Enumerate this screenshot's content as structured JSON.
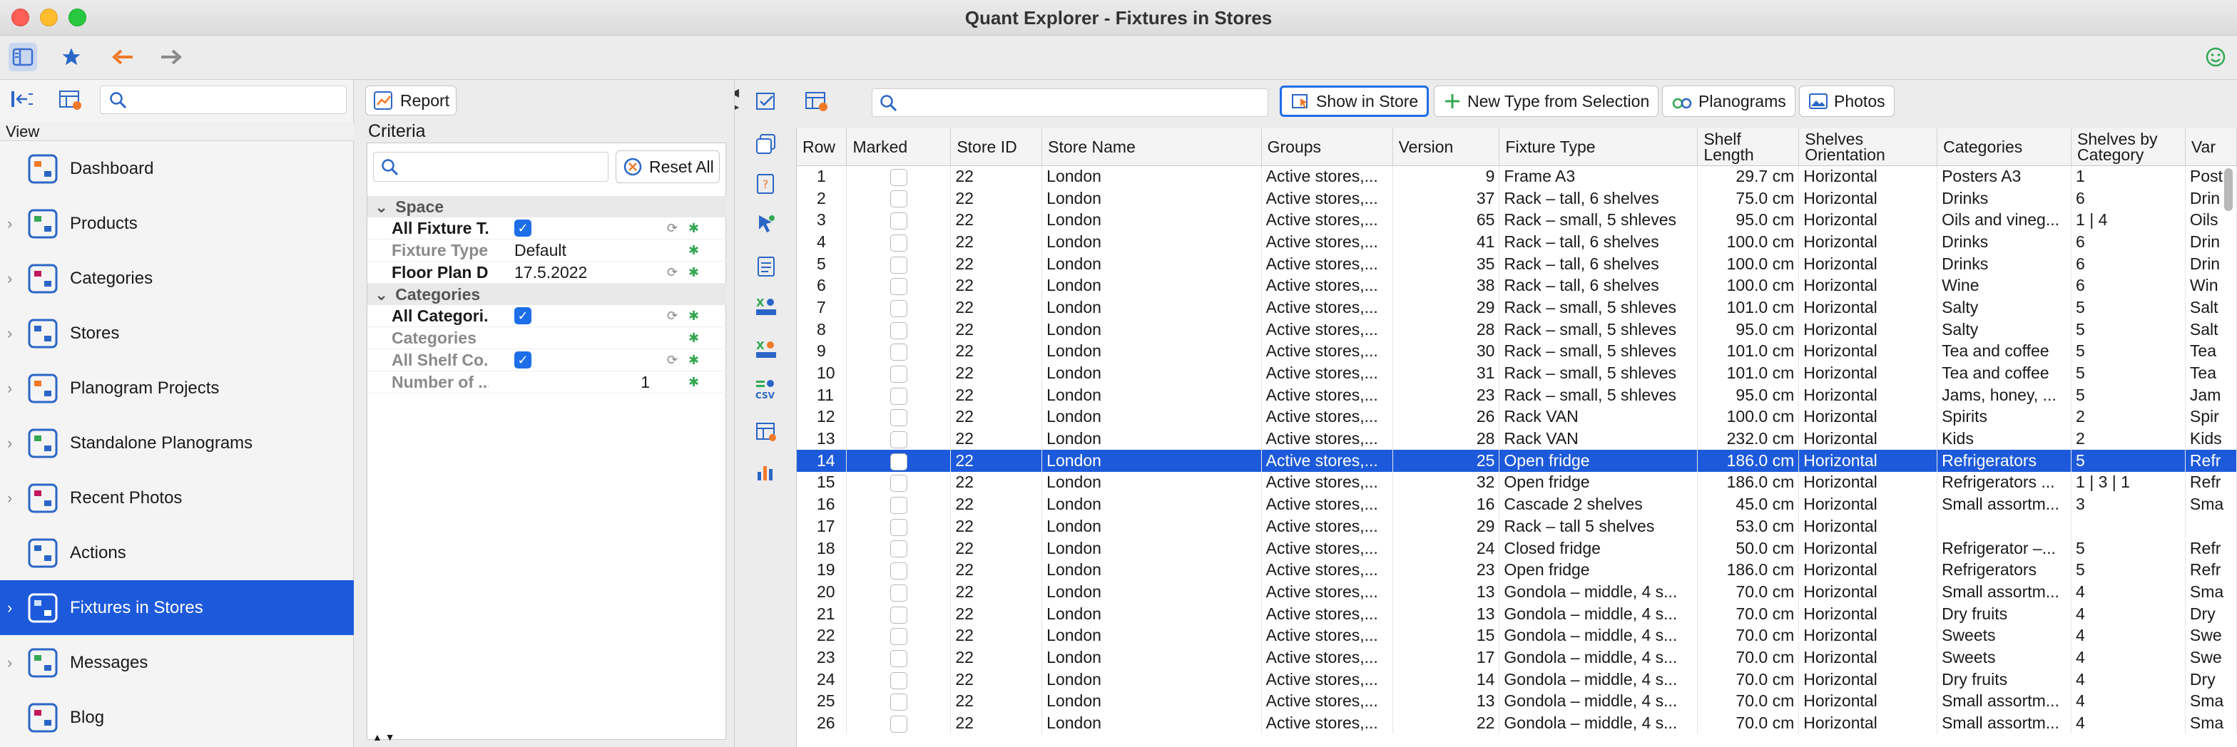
{
  "window": {
    "title": "Quant Explorer - Fixtures in Stores"
  },
  "nav": {
    "view_label": "View",
    "search_placeholder": "",
    "items": [
      {
        "label": "Dashboard",
        "icon": "dashboard-icon",
        "chevron": false
      },
      {
        "label": "Products",
        "icon": "products-icon",
        "chevron": true
      },
      {
        "label": "Categories",
        "icon": "categories-icon",
        "chevron": true
      },
      {
        "label": "Stores",
        "icon": "stores-icon",
        "chevron": true
      },
      {
        "label": "Planogram Projects",
        "icon": "planogram-projects-icon",
        "chevron": true
      },
      {
        "label": "Standalone Planograms",
        "icon": "standalone-planograms-icon",
        "chevron": true
      },
      {
        "label": "Recent Photos",
        "icon": "recent-photos-icon",
        "chevron": true
      },
      {
        "label": "Actions",
        "icon": "actions-icon",
        "chevron": false
      },
      {
        "label": "Fixtures in Stores",
        "icon": "fixtures-icon",
        "chevron": true,
        "selected": true
      },
      {
        "label": "Messages",
        "icon": "messages-icon",
        "chevron": true
      },
      {
        "label": "Blog",
        "icon": "blog-icon",
        "chevron": false
      }
    ]
  },
  "criteria": {
    "report_label": "Report",
    "title": "Criteria",
    "reset_label": "Reset All",
    "groups": [
      {
        "name": "Space",
        "rows": [
          {
            "name": "All Fixture T...",
            "value": "",
            "checkbox": true,
            "dim": false
          },
          {
            "name": "Fixture Type",
            "value": "Default",
            "checkbox": false,
            "dim": true
          },
          {
            "name": "Floor Plan D...",
            "value": "17.5.2022",
            "checkbox": false,
            "dim": false
          }
        ]
      },
      {
        "name": "Categories",
        "rows": [
          {
            "name": "All Categori...",
            "value": "",
            "checkbox": true,
            "dim": false
          },
          {
            "name": "Categories",
            "value": "",
            "checkbox": false,
            "dim": true
          },
          {
            "name": "All Shelf Co...",
            "value": "",
            "checkbox": true,
            "dim": true
          },
          {
            "name": "Number of ...",
            "value": "1",
            "checkbox": false,
            "dim": true
          }
        ]
      }
    ]
  },
  "grid": {
    "buttons": {
      "show_in_store": "Show in Store",
      "new_type": "New Type from Selection",
      "planograms": "Planograms",
      "photos": "Photos"
    },
    "columns": [
      "Row",
      "Marked",
      "Store ID",
      "Store Name",
      "Groups",
      "Version",
      "Fixture Type",
      "Shelf Length",
      "Shelves Orientation",
      "Categories",
      "Shelves by Category",
      "Var"
    ],
    "rows": [
      [
        "1",
        "22",
        "London",
        "Active stores,...",
        "9",
        "Frame A3",
        "29.7 cm",
        "Horizontal",
        "Posters A3",
        "1",
        "Post"
      ],
      [
        "2",
        "22",
        "London",
        "Active stores,...",
        "37",
        "Rack – tall, 6 shelves",
        "75.0 cm",
        "Horizontal",
        "Drinks",
        "6",
        "Drin"
      ],
      [
        "3",
        "22",
        "London",
        "Active stores,...",
        "65",
        "Rack – small, 5 shleves",
        "95.0 cm",
        "Horizontal",
        "Oils and vineg...",
        "1 | 4",
        "Oils"
      ],
      [
        "4",
        "22",
        "London",
        "Active stores,...",
        "41",
        "Rack – tall, 6 shelves",
        "100.0 cm",
        "Horizontal",
        "Drinks",
        "6",
        "Drin"
      ],
      [
        "5",
        "22",
        "London",
        "Active stores,...",
        "35",
        "Rack – tall, 6 shelves",
        "100.0 cm",
        "Horizontal",
        "Drinks",
        "6",
        "Drin"
      ],
      [
        "6",
        "22",
        "London",
        "Active stores,...",
        "38",
        "Rack – tall, 6 shelves",
        "100.0 cm",
        "Horizontal",
        "Wine",
        "6",
        "Win"
      ],
      [
        "7",
        "22",
        "London",
        "Active stores,...",
        "29",
        "Rack – small, 5 shleves",
        "101.0 cm",
        "Horizontal",
        "Salty",
        "5",
        "Salt"
      ],
      [
        "8",
        "22",
        "London",
        "Active stores,...",
        "28",
        "Rack – small, 5 shleves",
        "95.0 cm",
        "Horizontal",
        "Salty",
        "5",
        "Salt"
      ],
      [
        "9",
        "22",
        "London",
        "Active stores,...",
        "30",
        "Rack – small, 5 shleves",
        "101.0 cm",
        "Horizontal",
        "Tea and coffee",
        "5",
        "Tea"
      ],
      [
        "10",
        "22",
        "London",
        "Active stores,...",
        "31",
        "Rack – small, 5 shleves",
        "101.0 cm",
        "Horizontal",
        "Tea and coffee",
        "5",
        "Tea"
      ],
      [
        "11",
        "22",
        "London",
        "Active stores,...",
        "23",
        "Rack – small, 5 shleves",
        "95.0 cm",
        "Horizontal",
        "Jams, honey, ...",
        "5",
        "Jam"
      ],
      [
        "12",
        "22",
        "London",
        "Active stores,...",
        "26",
        "Rack VAN",
        "100.0 cm",
        "Horizontal",
        "Spirits",
        "2",
        "Spir"
      ],
      [
        "13",
        "22",
        "London",
        "Active stores,...",
        "28",
        "Rack VAN",
        "232.0 cm",
        "Horizontal",
        "Kids",
        "2",
        "Kids"
      ],
      [
        "14",
        "22",
        "London",
        "Active stores,...",
        "25",
        "Open fridge",
        "186.0 cm",
        "Horizontal",
        "Refrigerators",
        "5",
        "Refr"
      ],
      [
        "15",
        "22",
        "London",
        "Active stores,...",
        "32",
        "Open fridge",
        "186.0 cm",
        "Horizontal",
        "Refrigerators ...",
        "1 | 3 | 1",
        "Refr"
      ],
      [
        "16",
        "22",
        "London",
        "Active stores,...",
        "16",
        "Cascade 2 shelves",
        "45.0 cm",
        "Horizontal",
        "Small assortm...",
        "3",
        "Sma"
      ],
      [
        "17",
        "22",
        "London",
        "Active stores,...",
        "29",
        "Rack – tall 5 shelves",
        "53.0 cm",
        "Horizontal",
        "",
        "",
        ""
      ],
      [
        "18",
        "22",
        "London",
        "Active stores,...",
        "24",
        "Closed fridge",
        "50.0 cm",
        "Horizontal",
        "Refrigerator –...",
        "5",
        "Refr"
      ],
      [
        "19",
        "22",
        "London",
        "Active stores,...",
        "23",
        "Open fridge",
        "186.0 cm",
        "Horizontal",
        "Refrigerators",
        "5",
        "Refr"
      ],
      [
        "20",
        "22",
        "London",
        "Active stores,...",
        "13",
        "Gondola – middle, 4 s...",
        "70.0 cm",
        "Horizontal",
        "Small assortm...",
        "4",
        "Sma"
      ],
      [
        "21",
        "22",
        "London",
        "Active stores,...",
        "13",
        "Gondola – middle, 4 s...",
        "70.0 cm",
        "Horizontal",
        "Dry fruits",
        "4",
        "Dry"
      ],
      [
        "22",
        "22",
        "London",
        "Active stores,...",
        "15",
        "Gondola – middle, 4 s...",
        "70.0 cm",
        "Horizontal",
        "Sweets",
        "4",
        "Swe"
      ],
      [
        "23",
        "22",
        "London",
        "Active stores,...",
        "17",
        "Gondola – middle, 4 s...",
        "70.0 cm",
        "Horizontal",
        "Sweets",
        "4",
        "Swe"
      ],
      [
        "24",
        "22",
        "London",
        "Active stores,...",
        "14",
        "Gondola – middle, 4 s...",
        "70.0 cm",
        "Horizontal",
        "Dry fruits",
        "4",
        "Dry"
      ],
      [
        "25",
        "22",
        "London",
        "Active stores,...",
        "13",
        "Gondola – middle, 4 s...",
        "70.0 cm",
        "Horizontal",
        "Small assortm...",
        "4",
        "Sma"
      ],
      [
        "26",
        "22",
        "London",
        "Active stores,...",
        "22",
        "Gondola – middle, 4 s...",
        "70.0 cm",
        "Horizontal",
        "Small assortm...",
        "4",
        "Sma"
      ]
    ],
    "selected_row": "14"
  },
  "colors": {
    "accent": "#1d5adb",
    "focus": "#1d6ee8"
  }
}
